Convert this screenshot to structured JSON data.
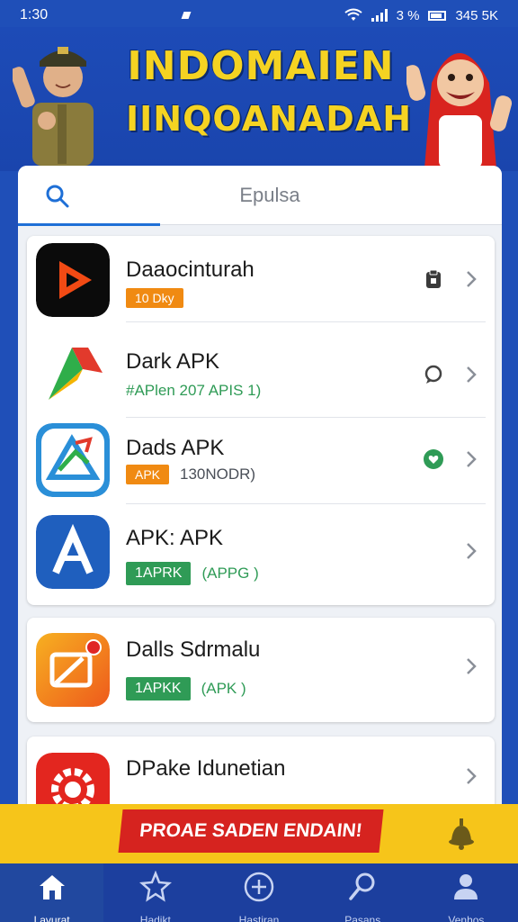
{
  "status_bar": {
    "time": "1:30",
    "battery_text": "3 %",
    "network_text": "345 5K"
  },
  "header": {
    "title_line1": "INDOMAIEN",
    "title_line2": "IINQOANADAH"
  },
  "search": {
    "placeholder": "Epulsa"
  },
  "apps": [
    {
      "name": "Daaocinturah",
      "badge": "10 Dky",
      "badge_type": "orange",
      "extra": "",
      "status_icon": "clipboard-icon"
    },
    {
      "name": "Dark APK",
      "badge": "",
      "badge_type": "text",
      "extra": "#APlen  207 APIS  1)",
      "status_icon": "chat-icon"
    },
    {
      "name": "Dads APK",
      "badge": "APK",
      "badge_type": "orange",
      "extra": "130NODR)",
      "status_icon": "heart-icon"
    },
    {
      "name": "APK: APK",
      "badge": "1APRK",
      "badge_type": "green",
      "extra": "(APPG )",
      "status_icon": ""
    },
    {
      "name": "Dalls Sdrmalu",
      "badge": "1APKK",
      "badge_type": "green",
      "extra": "(APK )",
      "status_icon": ""
    },
    {
      "name": "DPake Idunetian",
      "badge": "",
      "badge_type": "green",
      "extra": "",
      "status_icon": ""
    }
  ],
  "promo": {
    "label": "PROAE SADEN ENDAIN!"
  },
  "nav": [
    {
      "label": "Lavurat",
      "icon": "home-icon",
      "active": true
    },
    {
      "label": "Hadikt",
      "icon": "star-icon",
      "active": false
    },
    {
      "label": "Hastiran",
      "icon": "plus-circle-icon",
      "active": false
    },
    {
      "label": "Pasans",
      "icon": "search-icon",
      "active": false
    },
    {
      "label": "Venhos",
      "icon": "person-icon",
      "active": false
    }
  ],
  "colors": {
    "background": "#1f4fb8",
    "title_yellow": "#f5d322",
    "badge_orange": "#f08a12",
    "badge_green": "#2f9b56",
    "promo_yellow": "#f6c51a",
    "promo_red": "#d6231f",
    "nav_bg": "#1c3f9e"
  }
}
